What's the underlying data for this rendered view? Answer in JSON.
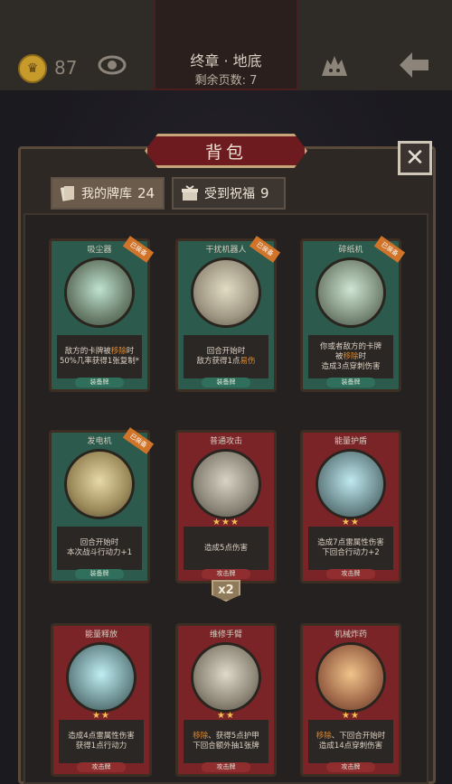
{
  "topbar": {
    "coins": "87",
    "chapter_title": "终章 · 地底",
    "pages_left": "剩余页数: 7"
  },
  "panel": {
    "title": "背包",
    "tabs": [
      {
        "label": "我的牌库",
        "count": "24",
        "active": true
      },
      {
        "label": "受到祝福",
        "count": "9",
        "active": false
      }
    ]
  },
  "cards": [
    {
      "name": "吸尘器",
      "frame": "green",
      "equipped_tag": "已装备",
      "desc": [
        "敌方的卡牌被",
        "移除",
        "时",
        "50%几率获得1张复制*"
      ],
      "footer": "装备牌"
    },
    {
      "name": "干扰机器人",
      "frame": "green",
      "equipped_tag": "已装备",
      "desc": [
        "回合开始时",
        "敌方获得1点",
        "易伤"
      ],
      "footer": "装备牌"
    },
    {
      "name": "碎纸机",
      "frame": "green",
      "equipped_tag": "已装备",
      "desc": [
        "你或者敌方的卡牌",
        "被",
        "移除",
        "时",
        "造成3点穿刺伤害"
      ],
      "footer": "装备牌"
    },
    {
      "name": "发电机",
      "frame": "green",
      "equipped_tag": "已装备",
      "desc": [
        "回合开始时",
        "本次战斗行动力+1"
      ],
      "footer": "装备牌"
    },
    {
      "name": "普通攻击",
      "frame": "red",
      "stars": "★★★",
      "desc": [
        "造成5点伤害"
      ],
      "footer": "攻击牌",
      "multiplier": "x2"
    },
    {
      "name": "能量护盾",
      "frame": "red",
      "stars": "★★",
      "desc": [
        "造成7点雷属性伤害",
        "下回合行动力+2"
      ],
      "footer": "攻击牌"
    },
    {
      "name": "能量释放",
      "frame": "red",
      "stars": "★★",
      "desc": [
        "造成4点雷属性伤害",
        "获得1点行动力"
      ],
      "footer": "攻击牌"
    },
    {
      "name": "维修手臂",
      "frame": "red",
      "stars": "★★",
      "desc": [
        "移除",
        "、获得5点护甲",
        "下回合额外抽1张牌"
      ],
      "footer": "攻击牌"
    },
    {
      "name": "机械炸药",
      "frame": "red",
      "stars": "★★",
      "desc": [
        "移除",
        "、下回合开始时",
        "造成14点穿刺伤害"
      ],
      "footer": "攻击牌"
    }
  ],
  "colors": {
    "accent_orange": "#e08a2e",
    "green_frame": "#2c5a4c",
    "red_frame": "#7a2428"
  }
}
